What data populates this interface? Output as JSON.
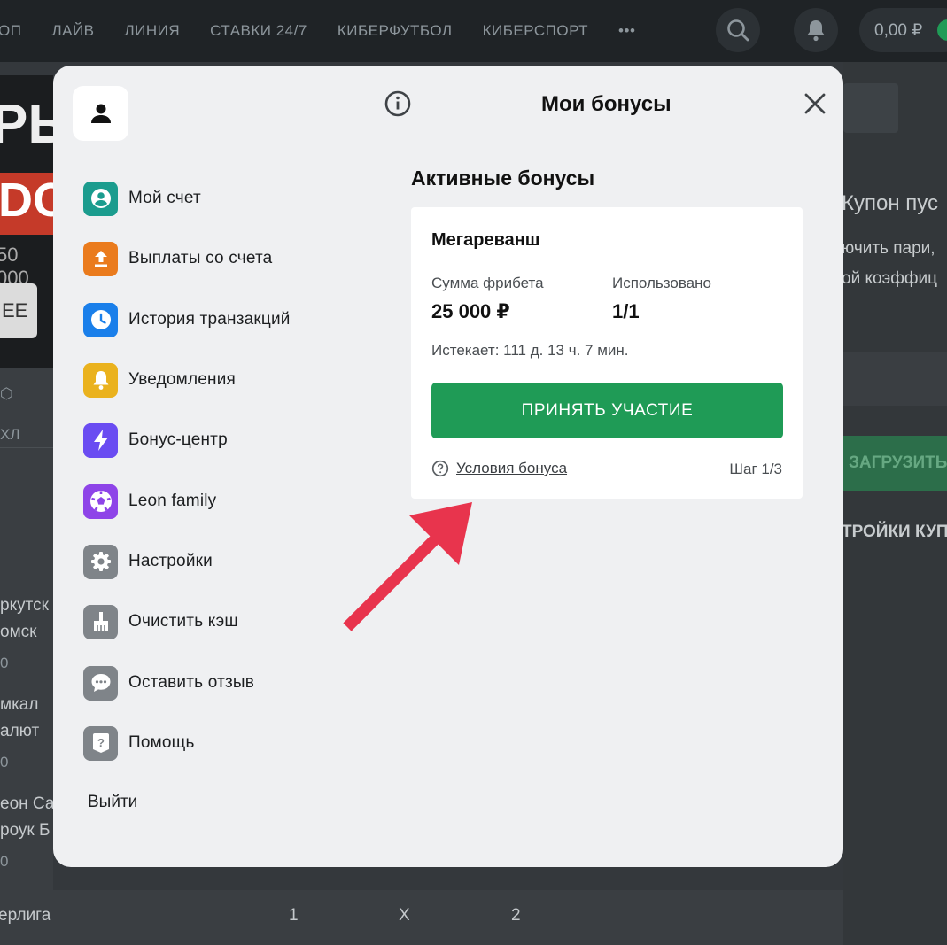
{
  "topbar": {
    "nav": [
      "ОП",
      "ЛАЙВ",
      "ЛИНИЯ",
      "СТАВКИ 24/7",
      "КИБЕРФУТБОЛ",
      "КИБЕРСПОРТ",
      "•••"
    ],
    "balance": "0,00 ₽",
    "icons": [
      "search-icon",
      "bell-icon"
    ]
  },
  "background": {
    "banner_line1": "РЫ",
    "banner_line2": "DOT",
    "banner_line3": "50 000",
    "banner_button": "EE",
    "league_short": "ХЛ",
    "rows": [
      {
        "a": "ркутск",
        "b": "омск",
        "c": "0"
      },
      {
        "a": "мкал",
        "b": "алют",
        "c": "0"
      },
      {
        "a": "еон Са",
        "b": "роук Б",
        "c": "0"
      }
    ],
    "bottom_row": {
      "label": "ерлига",
      "c1": "1",
      "cx": "X",
      "c2": "2"
    },
    "right": {
      "coupon_title": "Купон пус",
      "coupon_text1": "ючить пари,",
      "coupon_text2": "ой коэффиц",
      "upload": "ЗАГРУЗИТЬ",
      "settings": "ТРОЙКИ КУП"
    }
  },
  "modal": {
    "title": "Мои бонусы",
    "menu": [
      {
        "label": "Мой счет",
        "icon": "account-icon",
        "color": "#1b9c8e"
      },
      {
        "label": "Выплаты со счета",
        "icon": "withdraw-icon",
        "color": "#ea7b1d"
      },
      {
        "label": "История транзакций",
        "icon": "clock-icon",
        "color": "#1a7fea"
      },
      {
        "label": "Уведомления",
        "icon": "bell-icon",
        "color": "#eab21e"
      },
      {
        "label": "Бонус-центр",
        "icon": "lightning-icon",
        "color": "#6a4cf2"
      },
      {
        "label": "Leon family",
        "icon": "soccer-ball-icon",
        "color": "#8e44e8"
      },
      {
        "label": "Настройки",
        "icon": "gear-icon",
        "color": "#7f8489"
      },
      {
        "label": "Очистить кэш",
        "icon": "broom-icon",
        "color": "#7f8489"
      },
      {
        "label": "Оставить отзыв",
        "icon": "chat-icon",
        "color": "#7f8489"
      },
      {
        "label": "Помощь",
        "icon": "help-icon",
        "color": "#7f8489"
      }
    ],
    "logout": "Выйти",
    "section_title": "Активные бонусы",
    "card": {
      "name": "Мегареванш",
      "freebet_label": "Сумма фрибета",
      "freebet_value": "25 000 ₽",
      "used_label": "Использовано",
      "used_value": "1/1",
      "expires": "Истекает: 111 д. 13 ч. 7 мин.",
      "button": "ПРИНЯТЬ УЧАСТИЕ",
      "terms": "Условия бонуса",
      "step": "Шаг 1/3"
    },
    "accent_color": "#1f9b56",
    "arrow_color": "#e8344d"
  }
}
